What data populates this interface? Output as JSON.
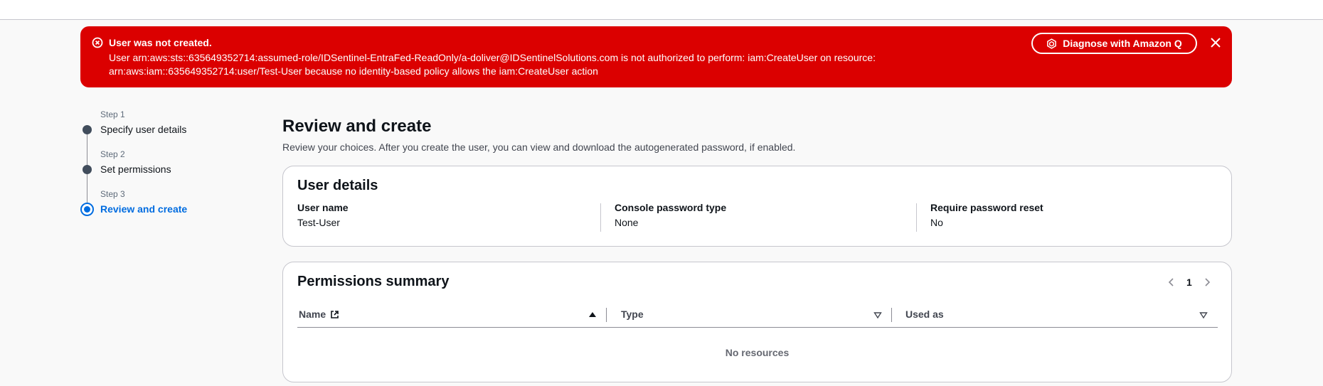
{
  "flash": {
    "title": "User was not created.",
    "message_line1": "User arn:aws:sts::635649352714:assumed-role/IDSentinel-EntraFed-ReadOnly/a-doliver@IDSentinelSolutions.com is not authorized to perform: iam:CreateUser on resource:",
    "message_line2": "arn:aws:iam::635649352714:user/Test-User because no identity-based policy allows the iam:CreateUser action",
    "diagnose_label": "Diagnose with Amazon Q",
    "type": "error",
    "color": "#db0000"
  },
  "wizard": {
    "steps": [
      {
        "number": "Step 1",
        "label": "Specify user details"
      },
      {
        "number": "Step 2",
        "label": "Set permissions"
      },
      {
        "number": "Step 3",
        "label": "Review and create"
      }
    ],
    "active_color": "#006ce0"
  },
  "main": {
    "title": "Review and create",
    "description": "Review your choices. After you create the user, you can view and download the autogenerated password, if enabled."
  },
  "user_details": {
    "title": "User details",
    "fields": [
      {
        "key": "User name",
        "value": "Test-User"
      },
      {
        "key": "Console password type",
        "value": "None"
      },
      {
        "key": "Require password reset",
        "value": "No"
      }
    ]
  },
  "permissions": {
    "title": "Permissions summary",
    "page": "1",
    "columns": [
      "Name",
      "Type",
      "Used as"
    ],
    "empty_text": "No resources"
  }
}
